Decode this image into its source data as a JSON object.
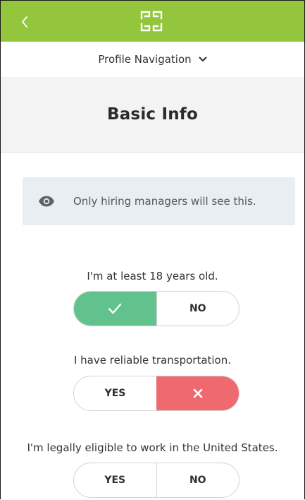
{
  "app": {
    "accent_color": "#93c63c"
  },
  "header": {
    "back_icon": "chevron-left-icon",
    "logo_icon": "app-logo-icon"
  },
  "profile_nav": {
    "label": "Profile Navigation",
    "icon": "chevron-down-icon"
  },
  "section": {
    "title": "Basic Info"
  },
  "notice": {
    "icon": "eye-icon",
    "text": "Only hiring managers will see this."
  },
  "questions": [
    {
      "label": "I'm at least 18 years old.",
      "yes_label": "YES",
      "no_label": "NO",
      "selected": "yes",
      "selected_icon": "check-icon"
    },
    {
      "label": "I have reliable transportation.",
      "yes_label": "YES",
      "no_label": "NO",
      "selected": "no",
      "selected_icon": "x-icon"
    },
    {
      "label": "I'm legally eligible to work in the United States.",
      "yes_label": "YES",
      "no_label": "NO",
      "selected": null
    }
  ],
  "colors": {
    "yes_selected": "#62c28e",
    "no_selected": "#ee6a6f"
  }
}
